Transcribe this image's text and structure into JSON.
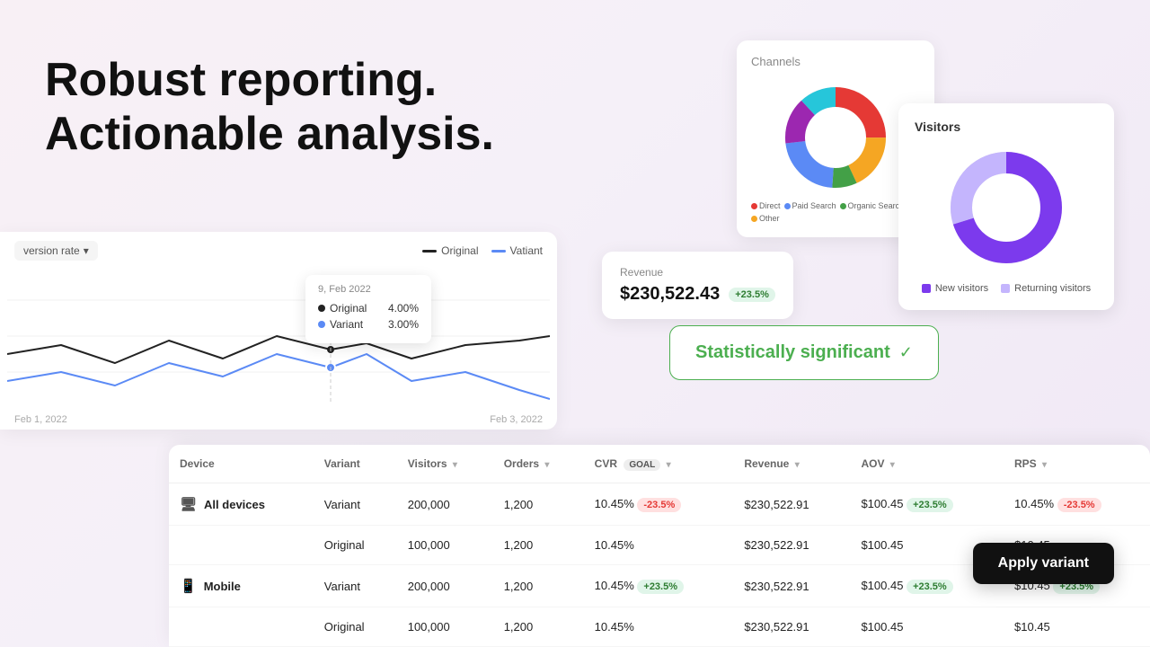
{
  "hero": {
    "line1": "Robust reporting.",
    "line2": "Actionable analysis."
  },
  "channels_card": {
    "title": "Channels"
  },
  "visitors_card": {
    "title": "Visitors",
    "legend": {
      "new": "New visitors",
      "returning": "Returning visitors"
    }
  },
  "revenue_card": {
    "label": "Revenue",
    "value": "$230,522.43",
    "badge": "+23.5%"
  },
  "stat_sig": {
    "text": "Statistically significant"
  },
  "chart": {
    "filter_label": "version rate",
    "legend_original": "Original",
    "legend_variant": "Vatiant",
    "tooltip": {
      "date": "9, Feb 2022",
      "original_label": "Original",
      "original_value": "4.00%",
      "variant_label": "Variant",
      "variant_value": "3.00%"
    },
    "xaxis": [
      "Feb 1, 2022",
      "Feb 3, 2022"
    ]
  },
  "table": {
    "columns": [
      "Device",
      "Variant",
      "Visitors",
      "Orders",
      "CVR",
      "Revenue",
      "AOV",
      "RPS"
    ],
    "goal_label": "GOAL",
    "rows": [
      {
        "device": "All devices",
        "device_icon": "🖥",
        "variant": "Variant",
        "visitors": "200,000",
        "orders": "1,200",
        "cvr": "10.45%",
        "cvr_badge": "-23.5%",
        "cvr_badge_type": "red",
        "revenue": "$230,522.91",
        "aov": "$100.45",
        "aov_badge": "+23.5%",
        "aov_badge_type": "green",
        "rps": "10.45%",
        "rps_badge": "-23.5%",
        "rps_badge_type": "red"
      },
      {
        "device": "",
        "device_icon": "",
        "variant": "Original",
        "visitors": "100,000",
        "orders": "1,200",
        "cvr": "10.45%",
        "cvr_badge": "",
        "revenue": "$230,522.91",
        "aov": "$100.45",
        "aov_badge": "",
        "rps": "$10.45",
        "rps_badge": ""
      },
      {
        "device": "Mobile",
        "device_icon": "📱",
        "variant": "Variant",
        "visitors": "200,000",
        "orders": "1,200",
        "cvr": "10.45%",
        "cvr_badge": "+23.5%",
        "cvr_badge_type": "green",
        "revenue": "$230,522.91",
        "aov": "$100.45",
        "aov_badge": "+23.5%",
        "aov_badge_type": "green",
        "rps": "$10.45",
        "rps_badge": "+23.5%",
        "rps_badge_type": "green"
      },
      {
        "device": "",
        "device_icon": "",
        "variant": "Original",
        "visitors": "100,000",
        "orders": "1,200",
        "cvr": "10.45%",
        "cvr_badge": "",
        "revenue": "$230,522.91",
        "aov": "$100.45",
        "aov_badge": "",
        "rps": "$10.45",
        "rps_badge": ""
      }
    ]
  },
  "apply_btn": {
    "label": "Apply variant"
  }
}
